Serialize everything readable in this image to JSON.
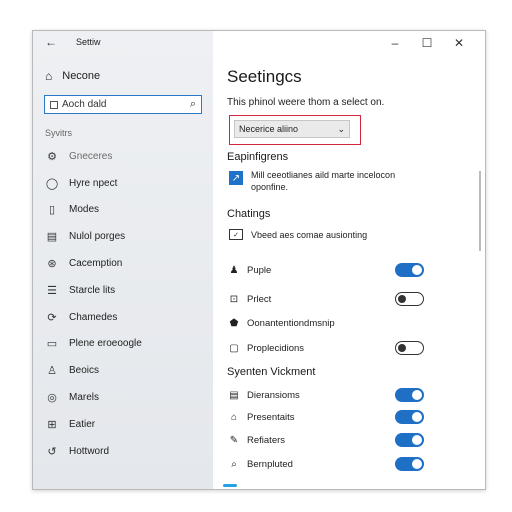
{
  "window": {
    "title": "Settiw"
  },
  "sidebar": {
    "home": "Necone",
    "search_value": "Aoch dald",
    "section": "Syvitrs",
    "items": [
      {
        "icon": "⚙",
        "label": "Gneceres",
        "dim": true
      },
      {
        "icon": "◯",
        "label": "Hyre npect"
      },
      {
        "icon": "▯",
        "label": "Modes"
      },
      {
        "icon": "▤",
        "label": "Nulol porges"
      },
      {
        "icon": "⊛",
        "label": "Cacemption"
      },
      {
        "icon": "☰",
        "label": "Starcle lits"
      },
      {
        "icon": "⟳",
        "label": "Chamedes"
      },
      {
        "icon": "▭",
        "label": "Plene eroeoogle"
      },
      {
        "icon": "♙",
        "label": "Beoics"
      },
      {
        "icon": "◎",
        "label": "Marels"
      },
      {
        "icon": "⊞",
        "label": "Eatier"
      },
      {
        "icon": "↺",
        "label": "Hottword"
      }
    ]
  },
  "main": {
    "title": "Seetingcs",
    "intro": "This phinol weere thom a select on.",
    "dropdown_value": "Necerice aliino",
    "section1": "Eapinfigrens",
    "info_line1": "Mill ceeotlianes aild marte incelocon",
    "info_line2": "oponfine.",
    "section2": "Chatings",
    "note": "Vbeed aes comae ausionting",
    "toggles1": [
      {
        "icon": "♟",
        "label": "Puple",
        "state": "on"
      },
      {
        "icon": "⊡",
        "label": "Prlect",
        "state": "off"
      },
      {
        "icon": "⬟",
        "label": "Oonantentiondmsnip",
        "state": "none"
      },
      {
        "icon": "▢",
        "label": "Proplecidions",
        "state": "off"
      }
    ],
    "section3": "Syenten Vickment",
    "toggles2": [
      {
        "icon": "▤",
        "label": "Dieransioms",
        "state": "on"
      },
      {
        "icon": "⌂",
        "label": "Presentaits",
        "state": "on"
      },
      {
        "icon": "✎",
        "label": "Refiaters",
        "state": "on"
      },
      {
        "icon": "⌕",
        "label": "Bernpluted",
        "state": "on"
      }
    ]
  },
  "colors": {
    "accent": "#1f6fc5",
    "focus_border": "#d0283a",
    "sidebar_bg": "#e9ecef"
  },
  "icons": {
    "back": "back-arrow-icon",
    "search": "search-icon",
    "home": "home-icon"
  }
}
